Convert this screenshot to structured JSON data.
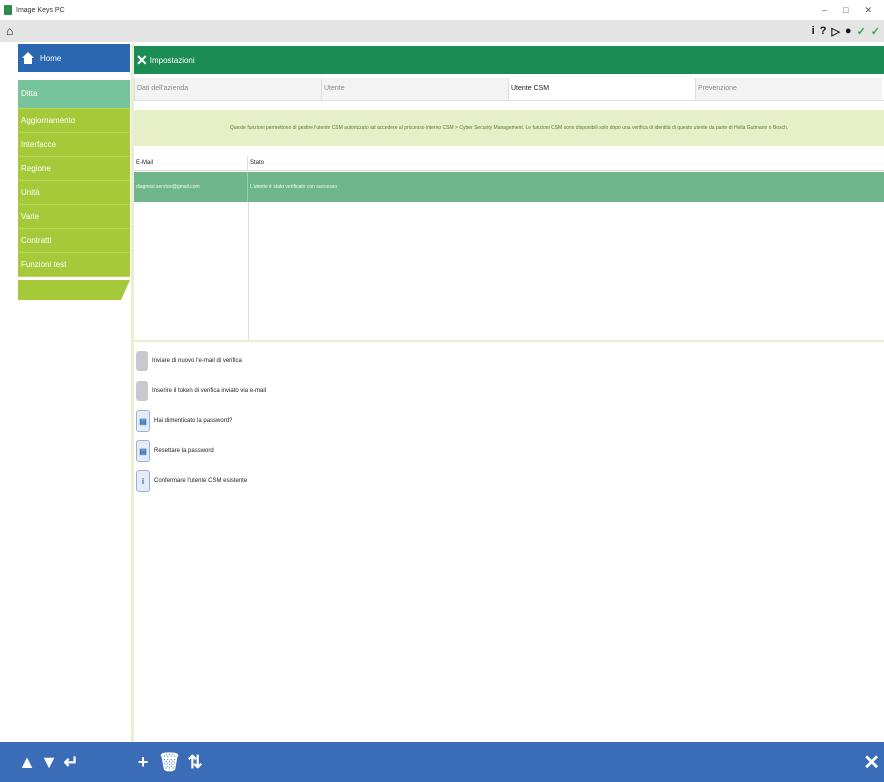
{
  "window": {
    "title": "Image Keys PC",
    "controls": [
      "–",
      "□",
      "✕"
    ]
  },
  "toolbar": {
    "home": "⌂",
    "icons": [
      "i",
      "?",
      "▷",
      "●",
      "✓",
      "✓"
    ]
  },
  "sidebar": {
    "home_label": "Home",
    "items": [
      {
        "label": "Ditta",
        "active": true
      },
      {
        "label": "Aggiornamento",
        "active": false
      },
      {
        "label": "Interfacce",
        "active": false
      },
      {
        "label": "Regione",
        "active": false
      },
      {
        "label": "Unità",
        "active": false
      },
      {
        "label": "Varie",
        "active": false
      },
      {
        "label": "Contratti",
        "active": false
      },
      {
        "label": "Funzioni test",
        "active": false
      }
    ]
  },
  "header": {
    "title": "Impostazioni"
  },
  "tabs": [
    {
      "label": "Dati dell'azienda",
      "active": false
    },
    {
      "label": "Utente",
      "active": false
    },
    {
      "label": "Utente CSM",
      "active": true
    },
    {
      "label": "Prevenzione",
      "active": false
    }
  ],
  "info": {
    "text": "Queste funzioni permettono di gestire l'utente CSM autorizzato ad accedere al processo interno CSM > Cyber Security Management. Le funzioni CSM sono disponibili solo dopo una verifica di identità di questo utente da parte di Hella Gutmann o Bosch."
  },
  "table": {
    "headers": {
      "email": "E-Mail",
      "stato": "Stato"
    },
    "rows": [
      {
        "email": "diagnosi.service@gmail.com",
        "stato": "L'utente è stato verificato con successo"
      }
    ]
  },
  "actions": [
    {
      "label": "Inviare di nuovo l'e-mail di verifica",
      "icon": "mail-icon",
      "style": "grey"
    },
    {
      "label": "Inserire il token di verifica inviato via e-mail",
      "icon": "token-icon",
      "style": "grey"
    },
    {
      "label": "Hai dimenticato la password?",
      "icon": "key-icon",
      "style": "blue"
    },
    {
      "label": "Resettare la password",
      "icon": "reset-icon",
      "style": "blue"
    },
    {
      "label": "Confermare l'utente CSM esistente",
      "icon": "info-icon",
      "style": "blue"
    }
  ],
  "bottombar": {
    "buttons": [
      "▲",
      "▼",
      "↵",
      "+",
      "🗑",
      "⇅"
    ],
    "close": "✕"
  },
  "colors": {
    "home_blue": "#2a67b0",
    "header_green": "#1c8c55",
    "nav_lime": "#a6c93a",
    "nav_active": "#78c49a",
    "row_selected": "#6fb68a",
    "bottombar": "#3a6cb8"
  }
}
